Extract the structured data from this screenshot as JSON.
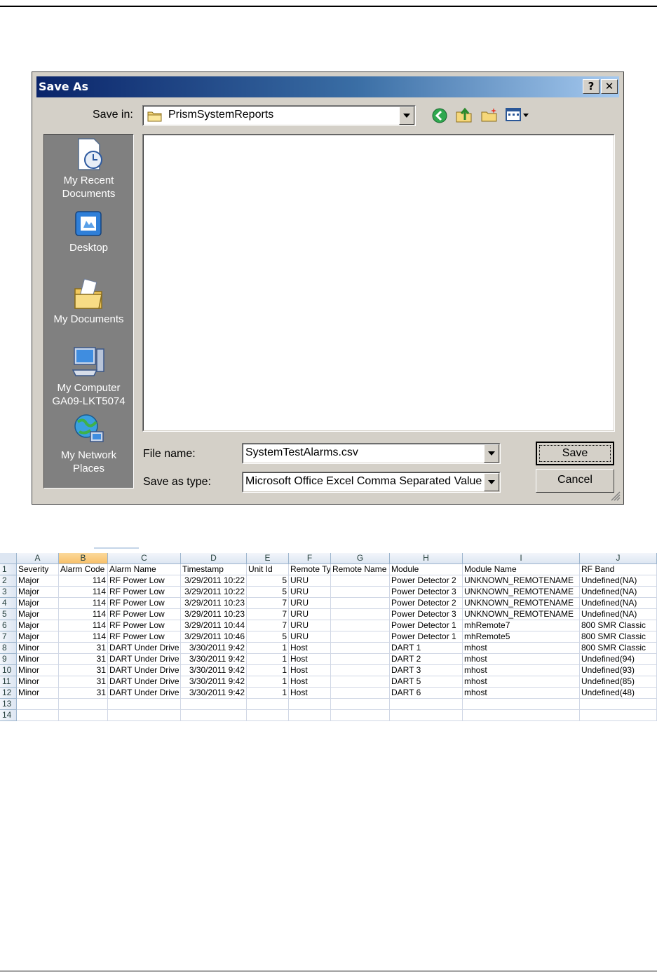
{
  "dialog": {
    "title": "Save As",
    "help_button": "?",
    "close_button": "✕",
    "save_in_label": "Save in:",
    "save_in_value": "PrismSystemReports",
    "places": [
      {
        "name": "my-recent-documents",
        "label_line1": "My Recent",
        "label_line2": "Documents"
      },
      {
        "name": "desktop",
        "label_line1": "Desktop",
        "label_line2": ""
      },
      {
        "name": "my-documents",
        "label_line1": "My Documents",
        "label_line2": ""
      },
      {
        "name": "my-computer",
        "label_line1": "My Computer",
        "label_line2": "GA09-LKT5074"
      },
      {
        "name": "my-network-places",
        "label_line1": "My Network",
        "label_line2": "Places"
      }
    ],
    "file_name_label": "File name:",
    "file_name_value": "SystemTestAlarms.csv",
    "save_type_label": "Save as type:",
    "save_type_value": "Microsoft Office Excel Comma Separated Values",
    "save_button": "Save",
    "cancel_button": "Cancel",
    "icons": [
      "back-icon",
      "up-folder-icon",
      "new-folder-icon",
      "views-menu-icon",
      "folder-icon"
    ]
  },
  "sheet": {
    "columns": [
      "A",
      "B",
      "C",
      "D",
      "E",
      "F",
      "G",
      "H",
      "I",
      "J"
    ],
    "selected_column": "B",
    "rows": [
      {
        "n": "1",
        "cells": [
          "Severity",
          "Alarm Code",
          "Alarm Name",
          "Timestamp",
          "Unit Id",
          "Remote Ty",
          "Remote Name",
          "Module",
          "Module Name",
          "RF Band"
        ]
      },
      {
        "n": "2",
        "cells": [
          "Major",
          "114",
          "RF Power Low",
          "3/29/2011 10:22",
          "5",
          "URU",
          "",
          "Power Detector 2",
          "UNKNOWN_REMOTENAME",
          "Undefined(NA)"
        ]
      },
      {
        "n": "3",
        "cells": [
          "Major",
          "114",
          "RF Power Low",
          "3/29/2011 10:22",
          "5",
          "URU",
          "",
          "Power Detector 3",
          "UNKNOWN_REMOTENAME",
          "Undefined(NA)"
        ]
      },
      {
        "n": "4",
        "cells": [
          "Major",
          "114",
          "RF Power Low",
          "3/29/2011 10:23",
          "7",
          "URU",
          "",
          "Power Detector 2",
          "UNKNOWN_REMOTENAME",
          "Undefined(NA)"
        ]
      },
      {
        "n": "5",
        "cells": [
          "Major",
          "114",
          "RF Power Low",
          "3/29/2011 10:23",
          "7",
          "URU",
          "",
          "Power Detector 3",
          "UNKNOWN_REMOTENAME",
          "Undefined(NA)"
        ]
      },
      {
        "n": "6",
        "cells": [
          "Major",
          "114",
          "RF Power Low",
          "3/29/2011 10:44",
          "7",
          "URU",
          "",
          "Power Detector 1",
          "mhRemote7",
          "800 SMR Classic"
        ]
      },
      {
        "n": "7",
        "cells": [
          "Major",
          "114",
          "RF Power Low",
          "3/29/2011 10:46",
          "5",
          "URU",
          "",
          "Power Detector 1",
          "mhRemote5",
          "800 SMR Classic"
        ]
      },
      {
        "n": "8",
        "cells": [
          "Minor",
          "31",
          "DART Under Drive",
          "3/30/2011 9:42",
          "1",
          "Host",
          "",
          "DART 1",
          "mhost",
          "800 SMR Classic"
        ]
      },
      {
        "n": "9",
        "cells": [
          "Minor",
          "31",
          "DART Under Drive",
          "3/30/2011 9:42",
          "1",
          "Host",
          "",
          "DART 2",
          "mhost",
          "Undefined(94)"
        ]
      },
      {
        "n": "10",
        "cells": [
          "Minor",
          "31",
          "DART Under Drive",
          "3/30/2011 9:42",
          "1",
          "Host",
          "",
          "DART 3",
          "mhost",
          "Undefined(93)"
        ]
      },
      {
        "n": "11",
        "cells": [
          "Minor",
          "31",
          "DART Under Drive",
          "3/30/2011 9:42",
          "1",
          "Host",
          "",
          "DART 5",
          "mhost",
          "Undefined(85)"
        ]
      },
      {
        "n": "12",
        "cells": [
          "Minor",
          "31",
          "DART Under Drive",
          "3/30/2011 9:42",
          "1",
          "Host",
          "",
          "DART 6",
          "mhost",
          "Undefined(48)"
        ]
      },
      {
        "n": "13",
        "cells": [
          "",
          "",
          "",
          "",
          "",
          "",
          "",
          "",
          "",
          ""
        ]
      },
      {
        "n": "14",
        "cells": [
          "",
          "",
          "",
          "",
          "",
          "",
          "",
          "",
          "",
          ""
        ]
      }
    ]
  }
}
